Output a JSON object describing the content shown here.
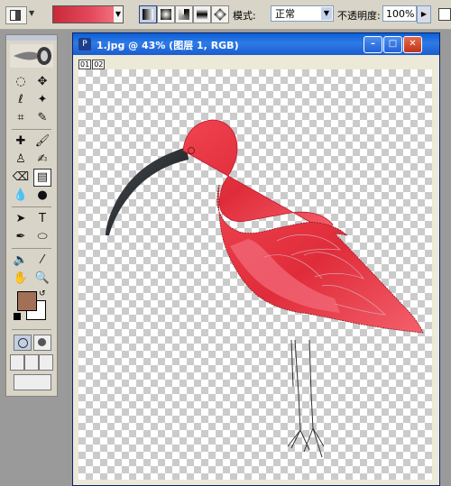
{
  "options_bar": {
    "mode_label": "模式:",
    "mode_value": "正常",
    "opacity_label": "不透明度:",
    "opacity_value": "100%"
  },
  "document": {
    "title": "1.jpg @ 43% (图层 1, RGB)",
    "ruler_tab_1": "01",
    "ruler_tab_2": "02"
  },
  "colors": {
    "foreground": "#a17056",
    "background": "#ffffff",
    "gradient_start": "#c82a3a",
    "gradient_end": "#f0707c",
    "bird_red": "#e8353f",
    "titlebar_blue": "#0a5fd8"
  }
}
